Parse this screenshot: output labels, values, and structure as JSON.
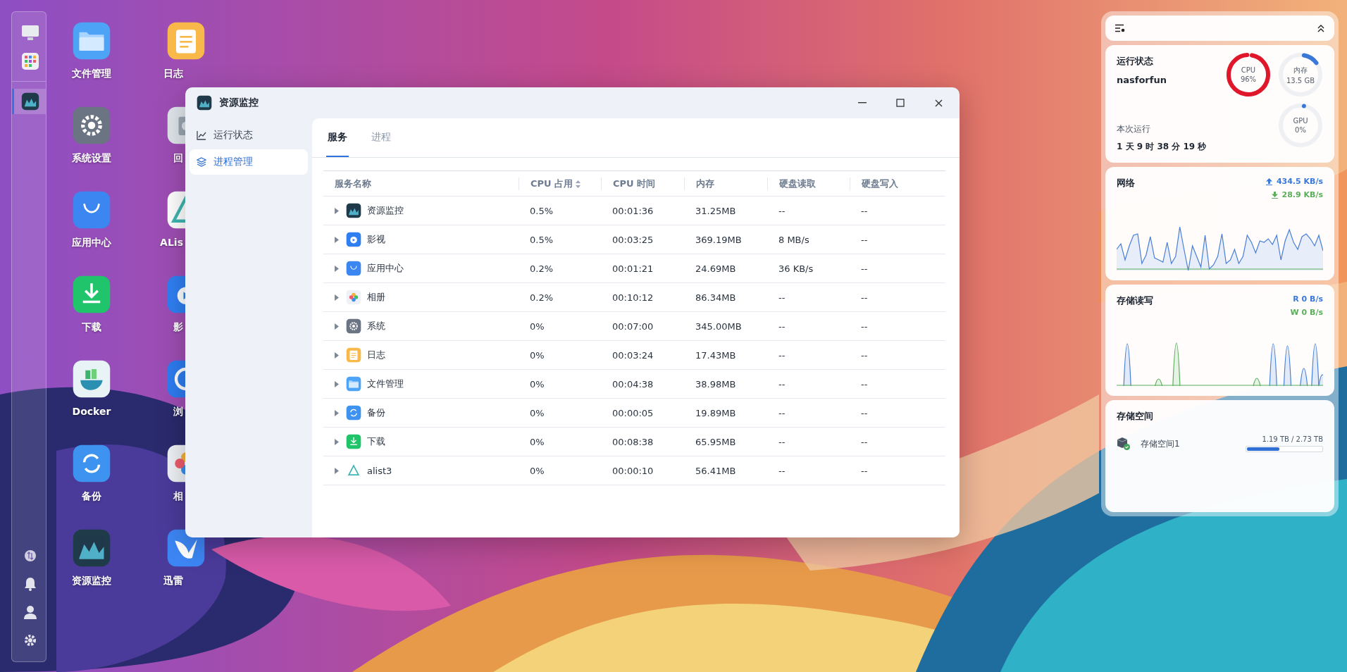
{
  "dock": {
    "top_items": [
      {
        "kind": "desktop"
      },
      {
        "kind": "apps"
      }
    ],
    "running": [
      {
        "kind": "monitor",
        "selected": true
      }
    ],
    "bottom_items": [
      {
        "kind": "transfer"
      },
      {
        "kind": "bell"
      },
      {
        "kind": "user"
      },
      {
        "kind": "settings"
      }
    ]
  },
  "desktop_icons": [
    {
      "label": "文件管理",
      "kind": "folder"
    },
    {
      "label": "系统设置",
      "kind": "settings"
    },
    {
      "label": "应用中心",
      "kind": "store"
    },
    {
      "label": "下载",
      "kind": "download"
    },
    {
      "label": "Docker",
      "kind": "docker"
    },
    {
      "label": "备份",
      "kind": "backup"
    },
    {
      "label": "资源监控",
      "kind": "monitor"
    },
    {
      "label": "日志",
      "kind": "log"
    },
    {
      "label": "回",
      "kind": "trash"
    },
    {
      "label": "ALis",
      "kind": "alist"
    },
    {
      "label": "影",
      "kind": "video"
    },
    {
      "label": "浏",
      "kind": "browser"
    },
    {
      "label": "相",
      "kind": "photos"
    },
    {
      "label": "迅雷",
      "kind": "xunlei"
    }
  ],
  "window": {
    "title": "资源监控",
    "sidebar": {
      "items": [
        {
          "label": "运行状态",
          "kind": "chart",
          "selected": false
        },
        {
          "label": "进程管理",
          "kind": "layers",
          "selected": true
        }
      ]
    },
    "tabs": [
      {
        "label": "服务",
        "selected": true
      },
      {
        "label": "进程",
        "selected": false
      }
    ],
    "table": {
      "columns": [
        {
          "label": "服务名称",
          "sortable": false
        },
        {
          "label": "CPU 占用",
          "sortable": true
        },
        {
          "label": "CPU 时间",
          "sortable": false
        },
        {
          "label": "内存",
          "sortable": false
        },
        {
          "label": "硬盘读取",
          "sortable": false
        },
        {
          "label": "硬盘写入",
          "sortable": false
        }
      ],
      "rows": [
        {
          "kind": "monitor",
          "name": "资源监控",
          "expanded": false,
          "cpu": "0.5%",
          "cpu_time": "00:01:36",
          "memory": "31.25MB",
          "disk_read": "--",
          "disk_write": "--"
        },
        {
          "kind": "video",
          "name": "影视",
          "expanded": false,
          "cpu": "0.5%",
          "cpu_time": "00:03:25",
          "memory": "369.19MB",
          "disk_read": "8 MB/s",
          "disk_write": "--"
        },
        {
          "kind": "store",
          "name": "应用中心",
          "expanded": false,
          "cpu": "0.2%",
          "cpu_time": "00:01:21",
          "memory": "24.69MB",
          "disk_read": "36 KB/s",
          "disk_write": "--"
        },
        {
          "kind": "photos",
          "name": "相册",
          "expanded": false,
          "cpu": "0.2%",
          "cpu_time": "00:10:12",
          "memory": "86.34MB",
          "disk_read": "--",
          "disk_write": "--"
        },
        {
          "kind": "settings",
          "name": "系统",
          "expanded": false,
          "cpu": "0%",
          "cpu_time": "00:07:00",
          "memory": "345.00MB",
          "disk_read": "--",
          "disk_write": "--"
        },
        {
          "kind": "log",
          "name": "日志",
          "expanded": false,
          "cpu": "0%",
          "cpu_time": "00:03:24",
          "memory": "17.43MB",
          "disk_read": "--",
          "disk_write": "--"
        },
        {
          "kind": "folder",
          "name": "文件管理",
          "expanded": false,
          "cpu": "0%",
          "cpu_time": "00:04:38",
          "memory": "38.98MB",
          "disk_read": "--",
          "disk_write": "--"
        },
        {
          "kind": "backup",
          "name": "备份",
          "expanded": false,
          "cpu": "0%",
          "cpu_time": "00:00:05",
          "memory": "19.89MB",
          "disk_read": "--",
          "disk_write": "--"
        },
        {
          "kind": "download",
          "name": "下载",
          "expanded": false,
          "cpu": "0%",
          "cpu_time": "00:08:38",
          "memory": "65.95MB",
          "disk_read": "--",
          "disk_write": "--"
        },
        {
          "kind": "alist",
          "name": "alist3",
          "expanded": false,
          "cpu": "0%",
          "cpu_time": "00:00:10",
          "memory": "56.41MB",
          "disk_read": "--",
          "disk_write": "--"
        }
      ]
    }
  },
  "widgets": {
    "status": {
      "title": "运行状态",
      "hostname": "nasforfun",
      "uptime_label": "本次运行",
      "uptime": "1 天 9 时 38 分 19 秒",
      "gauges": [
        {
          "label": "CPU",
          "value": "96%",
          "level": 0.96,
          "color": "#e0162b"
        },
        {
          "label": "内存",
          "value": "13.5 GB",
          "level": 0.12,
          "color": "#3a78d8"
        },
        {
          "label": "GPU",
          "value": "0%",
          "level": 0,
          "color": "#3a78d8"
        }
      ]
    },
    "network": {
      "title": "网络",
      "upload": "434.5 KB/s",
      "download": "28.9 KB/s"
    },
    "storage_io": {
      "title": "存储读写",
      "read": "R 0 B/s",
      "write": "W 0 B/s"
    },
    "storage": {
      "title": "存储空间",
      "volumes": [
        {
          "name": "存储空间1",
          "usage": "1.19 TB / 2.73 TB",
          "level": 0.436
        }
      ]
    }
  }
}
